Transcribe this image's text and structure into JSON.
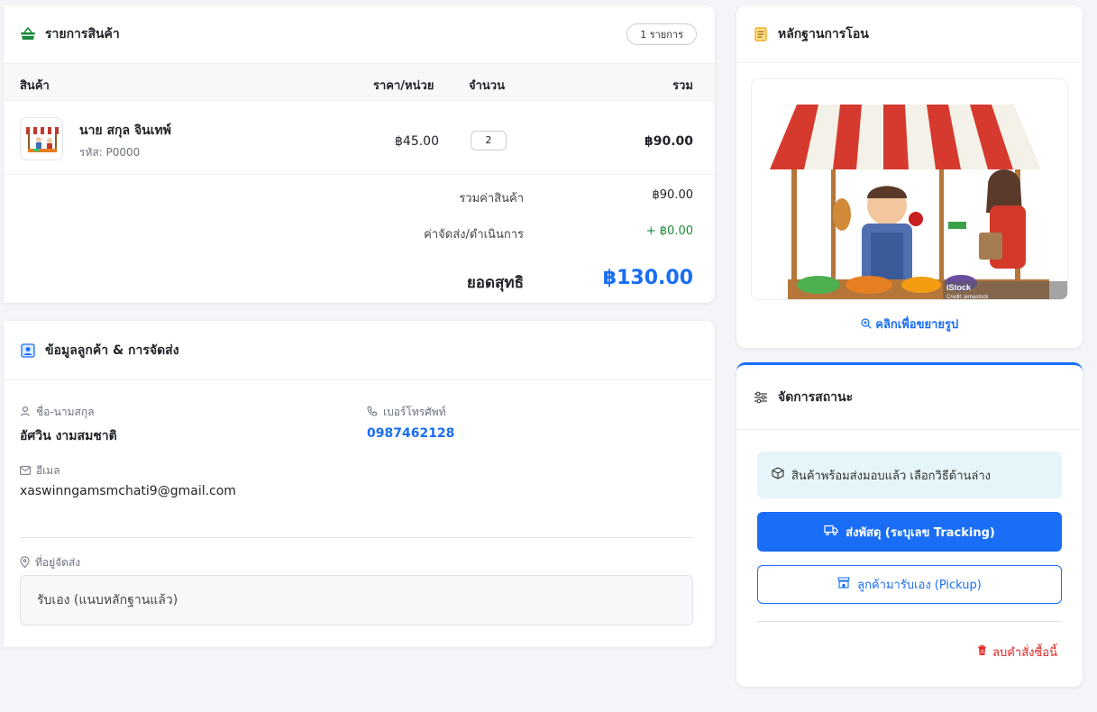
{
  "products": {
    "title": "รายการสินค้า",
    "count_badge": "1 รายการ",
    "columns": {
      "product": "สินค้า",
      "unit_price": "ราคา/หน่วย",
      "quantity": "จำนวน",
      "total": "รวม"
    },
    "items": [
      {
        "name": "นาย สกุล จินเทพ์",
        "sku": "รหัส: P0000",
        "price": "฿45.00",
        "qty": "2",
        "total": "฿90.00"
      }
    ],
    "summary": {
      "subtotal_label": "รวมค่าสินค้า",
      "subtotal": "฿90.00",
      "shipping_label": "ค่าจัดส่ง/ดำเนินการ",
      "shipping": "+ ฿0.00",
      "net_label": "ยอดสุทธิ",
      "net": "฿130.00"
    }
  },
  "customer": {
    "title": "ข้อมูลลูกค้า & การจัดส่ง",
    "name_label": "ชื่อ-นามสกุล",
    "name": "อัศวิน งามสมชาติ",
    "phone_label": "เบอร์โทรศัพท์",
    "phone": "0987462128",
    "email_label": "อีเมล",
    "email": "xaswinngamsmchati9@gmail.com",
    "address_label": "ที่อยู่จัดส่ง",
    "address": "รับเอง (แนบหลักฐานแล้ว)"
  },
  "proof": {
    "title": "หลักฐานการโอน",
    "enlarge_label": "คลิกเพื่อขยายรูป",
    "watermark": "iStock",
    "watermark_credit": "Credit: jemastock"
  },
  "status": {
    "title": "จัดการสถานะ",
    "info": "สินค้าพร้อมส่งมอบแล้ว เลือกวิธีด้านล่าง",
    "ship_button": "ส่งพัสดุ (ระบุเลข Tracking)",
    "pickup_button": "ลูกค้ามารับเอง (Pickup)",
    "delete_label": "ลบคำสั่งซื้อนี้"
  },
  "colors": {
    "accent": "#1a6ef5",
    "success": "#1a8a3a",
    "danger": "#e02424",
    "info_bg": "#e6f5f9"
  }
}
